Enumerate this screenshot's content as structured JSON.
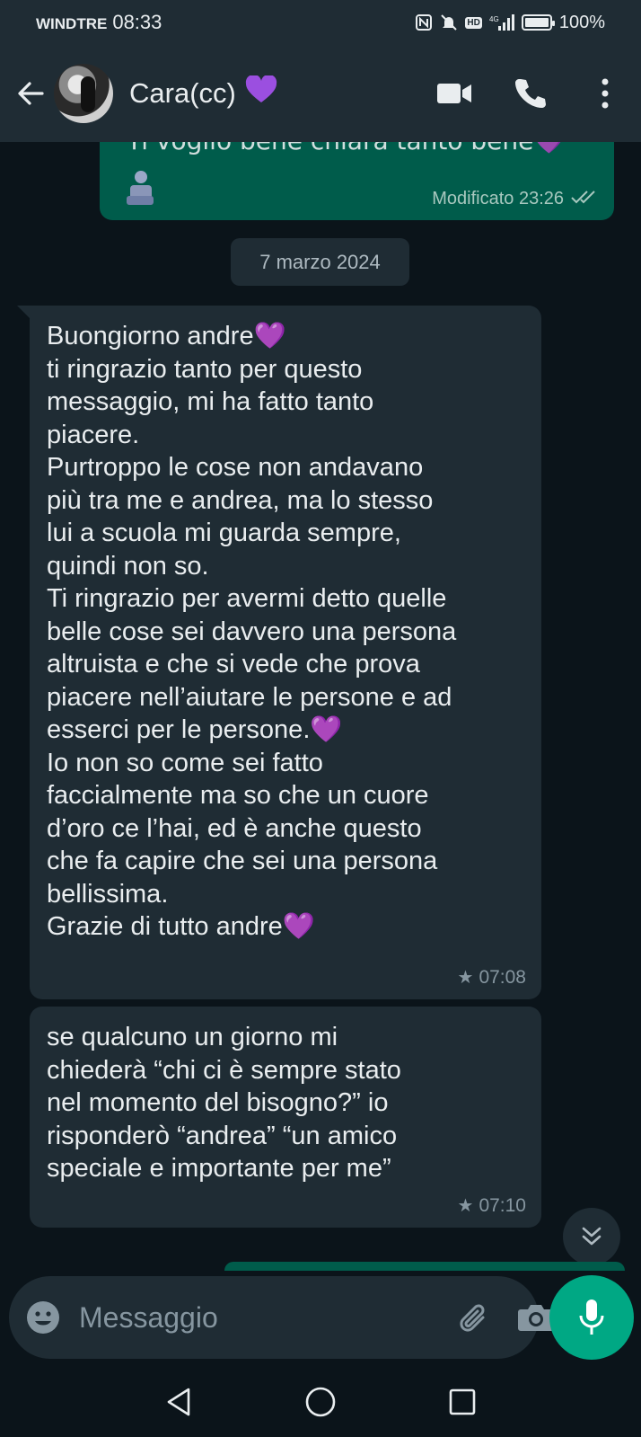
{
  "status_bar": {
    "carrier": "WINDTRE",
    "time": "08:33",
    "network": "4G",
    "hd_label": "HD",
    "battery": "100%",
    "battery_level": 1.0
  },
  "header": {
    "contact_name": "Cara(cc)",
    "contact_emoji": "💜",
    "icons": [
      "back-arrow-icon",
      "video-call-icon",
      "phone-icon",
      "more-vert-icon"
    ]
  },
  "chat": {
    "outgoing_partial": {
      "text": "Ti voglio bene chiara tanto bene💜",
      "meta": "Modificato 23:26"
    },
    "date_chip": "7 marzo 2024",
    "messages": [
      {
        "text": "Buongiorno andre💜\nti ringrazio tanto per questo\nmessaggio, mi ha fatto tanto\npiacere.\nPurtroppo le cose non andavano\npiù tra me e andrea, ma lo stesso\nlui a scuola mi guarda sempre,\nquindi non so.\nTi ringrazio per avermi detto quelle\nbelle cose sei davvero una persona\naltruista e che si vede che prova\npiacere nell’aiutare le persone e ad\nesserci per le persone.💜\nIo non so come sei fatto\nfaccialmente ma so che un cuore\nd’oro ce l’hai, ed è anche questo\nche fa capire che sei una persona\nbellissima.\nGrazie di tutto andre💜",
        "time": "07:08",
        "starred": true
      },
      {
        "text": "se qualcuno un giorno mi\nchiederà “chi ci è sempre stato\nnel momento del bisogno?” io\nrisponderò “andrea” “un amico\nspeciale e importante per me”",
        "time": "07:10",
        "starred": true
      }
    ]
  },
  "composer": {
    "placeholder": "Messaggio"
  },
  "colors": {
    "background": "#0b141a",
    "bar": "#1f2c34",
    "incoming": "#1f2c34",
    "outgoing": "#005c4b",
    "accent": "#00a884",
    "muted": "#8696a0"
  }
}
